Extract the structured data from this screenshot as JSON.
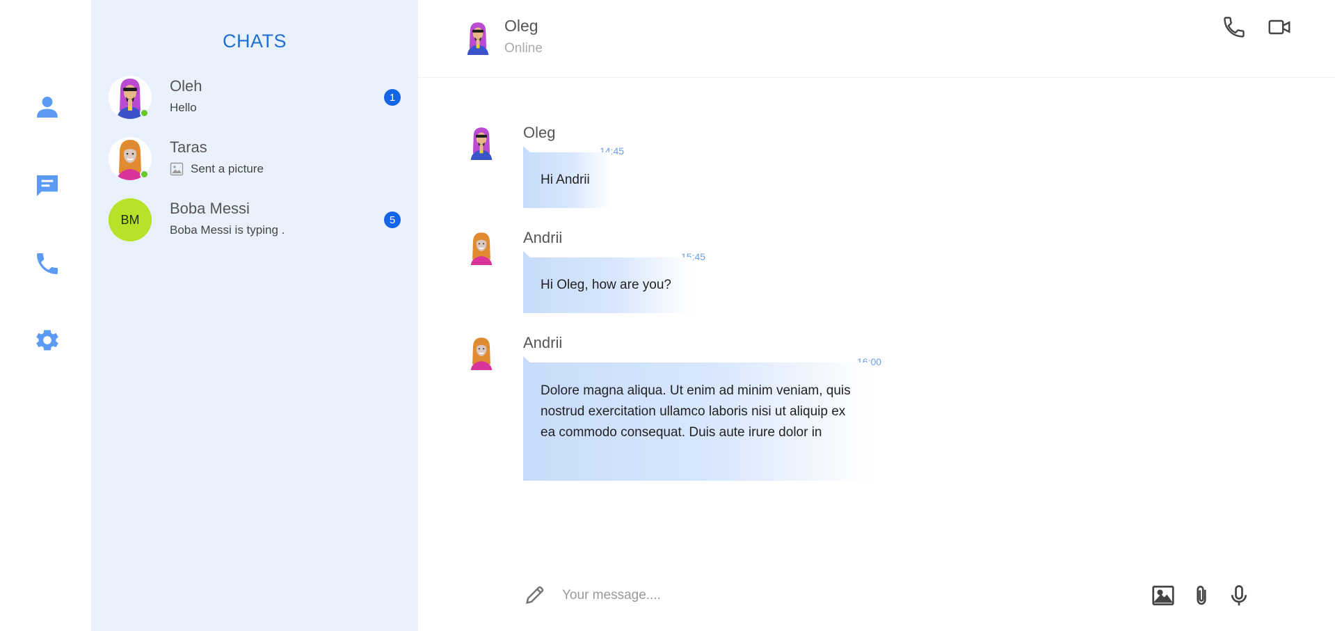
{
  "colors": {
    "accent": "#1364e6",
    "rail_icon": "#5b9bf3",
    "panel_bg": "#e9f1fd",
    "online": "#6cc72c",
    "initials_bg": "#b6e227"
  },
  "rail": {
    "items": [
      {
        "icon": "user-icon"
      },
      {
        "icon": "chat-bubble-icon"
      },
      {
        "icon": "phone-icon"
      },
      {
        "icon": "gear-icon"
      }
    ]
  },
  "chatlist": {
    "title": "CHATS",
    "chats": [
      {
        "name": "Oleh",
        "preview": "Hello",
        "badge": "1",
        "online": true,
        "avatar": "avatar-purple"
      },
      {
        "name": "Taras",
        "preview": "Sent a picture",
        "badge": "",
        "online": true,
        "avatar": "avatar-orange",
        "preview_icon": "image-icon"
      },
      {
        "name": "Boba Messi",
        "preview": "Boba Messi is typing .",
        "badge": "5",
        "online": false,
        "initials": "BM"
      }
    ]
  },
  "header": {
    "name": "Oleg",
    "status": "Online",
    "actions": [
      {
        "icon": "phone-icon"
      },
      {
        "icon": "video-camera-icon"
      }
    ]
  },
  "messages": [
    {
      "sender": "Oleg",
      "time": "14:45",
      "text": "Hi Andrii",
      "avatar": "avatar-purple"
    },
    {
      "sender": "Andrii",
      "time": "15:45",
      "text": "Hi Oleg, how are you?",
      "avatar": "avatar-orange"
    },
    {
      "sender": "Andrii",
      "time": "16:00",
      "text": "Dolore magna aliqua. Ut enim ad minim veniam, quis nostrud exercitation ullamco laboris nisi ut aliquip ex ea commodo consequat. Duis aute irure dolor in",
      "avatar": "avatar-orange"
    }
  ],
  "composer": {
    "placeholder": "Your message....",
    "value": "",
    "actions": [
      {
        "icon": "image-icon"
      },
      {
        "icon": "paperclip-icon"
      },
      {
        "icon": "microphone-icon"
      }
    ]
  }
}
